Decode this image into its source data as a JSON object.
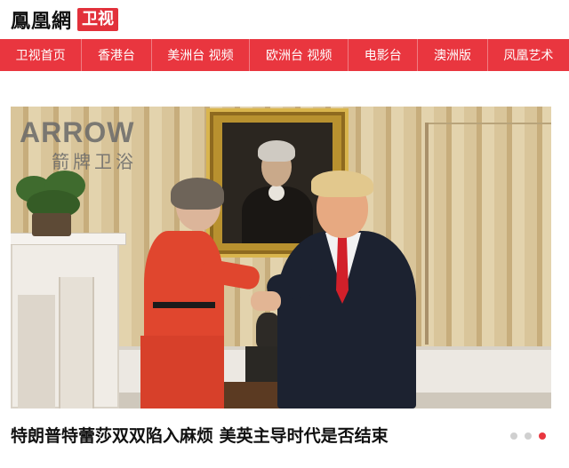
{
  "brand": {
    "name": "鳳凰網",
    "channel_badge": "卫视",
    "accent_color": "#e9363f"
  },
  "nav": {
    "items": [
      {
        "label": "卫视首页"
      },
      {
        "label": "香港台"
      },
      {
        "label": "美洲台  视频"
      },
      {
        "label": "欧洲台  视频"
      },
      {
        "label": "电影台"
      },
      {
        "label": "澳洲版"
      },
      {
        "label": "凤凰艺术"
      }
    ]
  },
  "hero": {
    "ad_main": "ARROW",
    "ad_sub": "箭牌卫浴",
    "caption": "特朗普特蕾莎双双陷入麻烦 美英主导时代是否结束"
  },
  "carousel": {
    "total": 3,
    "active_index": 3
  }
}
